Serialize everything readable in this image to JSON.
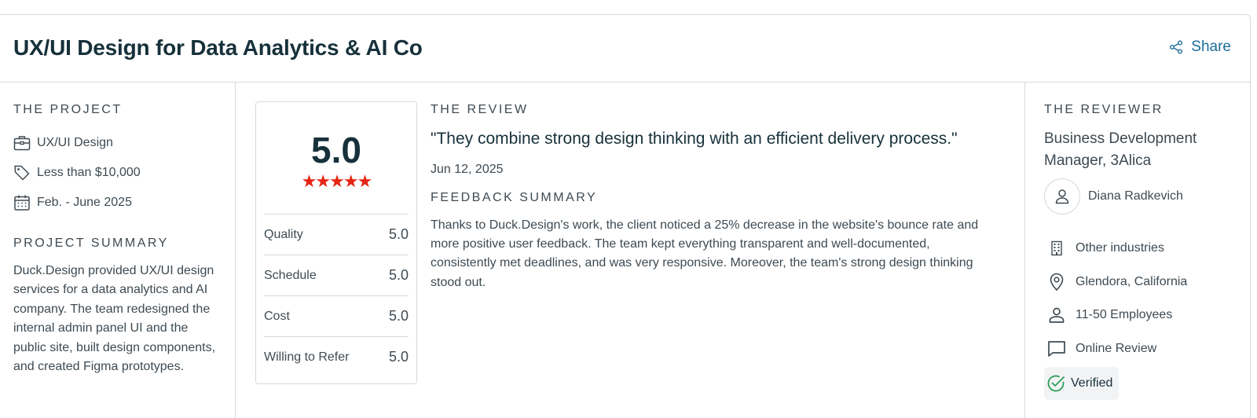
{
  "header": {
    "title": "UX/UI Design for Data Analytics & AI Co",
    "share_label": "Share"
  },
  "project": {
    "section_label": "THE PROJECT",
    "service": "UX/UI Design",
    "budget": "Less than $10,000",
    "dates": "Feb. - June 2025",
    "summary_label": "PROJECT SUMMARY",
    "summary": "Duck.Design provided UX/UI design services for a data analytics and AI company. The team redesigned the internal admin panel UI and the public site, built design components, and created Figma prototypes."
  },
  "rating": {
    "overall": "5.0",
    "stars": 5,
    "scores": [
      {
        "label": "Quality",
        "value": "5.0"
      },
      {
        "label": "Schedule",
        "value": "5.0"
      },
      {
        "label": "Cost",
        "value": "5.0"
      },
      {
        "label": "Willing to Refer",
        "value": "5.0"
      }
    ]
  },
  "review": {
    "section_label": "THE REVIEW",
    "quote": "\"They combine strong design thinking with an efficient delivery process.\"",
    "date": "Jun 12, 2025",
    "feedback_label": "FEEDBACK SUMMARY",
    "feedback": "Thanks to Duck.Design's work, the client noticed a 25% decrease in the website's bounce rate and more positive user feedback. The team kept everything transparent and well-documented, consistently met deadlines, and was very responsive. Moreover, the team's strong design thinking stood out."
  },
  "reviewer": {
    "section_label": "THE REVIEWER",
    "title": "Business Development Manager, 3Alica",
    "name": "Diana Radkevich",
    "industry": "Other industries",
    "location": "Glendora, California",
    "size": "11-50 Employees",
    "review_type": "Online Review",
    "verified": "Verified"
  },
  "colors": {
    "accent": "#1a6e98",
    "star": "#e62415",
    "verified": "#2e9e5b",
    "heading": "#17313b"
  }
}
